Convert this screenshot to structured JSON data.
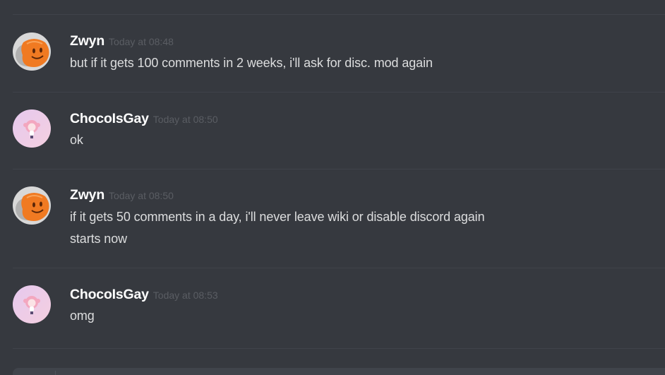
{
  "messages": [
    {
      "author": "Zwyn",
      "timestamp": "Today at 08:48",
      "avatar_icon": "orange-blob-avatar",
      "lines": [
        "but if it gets 100 comments in 2 weeks, i'll ask for disc. mod again"
      ]
    },
    {
      "author": "ChocoIsGay",
      "timestamp": "Today at 08:50",
      "avatar_icon": "anime-girl-avatar",
      "lines": [
        "ok"
      ]
    },
    {
      "author": "Zwyn",
      "timestamp": "Today at 08:50",
      "avatar_icon": "orange-blob-avatar",
      "lines": [
        "if it gets 50 comments in a day, i'll never leave wiki or disable discord again",
        "starts now"
      ]
    },
    {
      "author": "ChocoIsGay",
      "timestamp": "Today at 08:53",
      "avatar_icon": "anime-girl-avatar",
      "lines": [
        "omg"
      ]
    }
  ],
  "colors": {
    "background": "#36393f",
    "author": "#ffffff",
    "timestamp": "#5a5d63",
    "message_text": "#dcddde",
    "divider": "#40434a"
  }
}
